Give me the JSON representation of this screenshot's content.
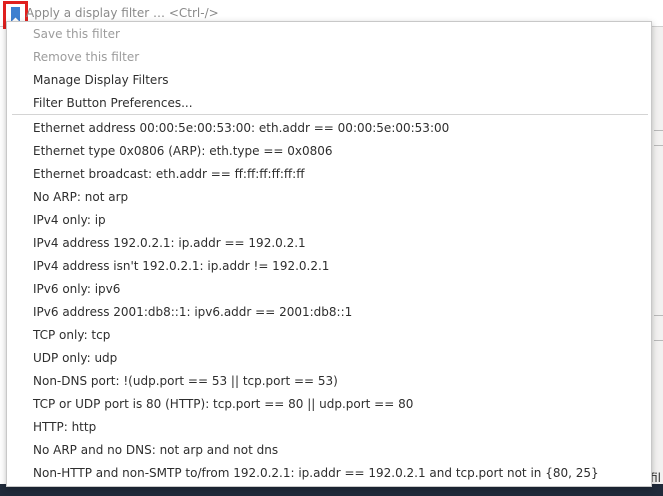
{
  "filter_toolbar": {
    "bookmark_icon": "bookmark-icon",
    "placeholder": "Apply a display filter … <Ctrl-/>"
  },
  "menu": {
    "actions": [
      {
        "label": "Save this filter",
        "enabled": false
      },
      {
        "label": "Remove this filter",
        "enabled": false
      },
      {
        "label": "Manage Display Filters",
        "enabled": true
      },
      {
        "label": "Filter Button Preferences...",
        "enabled": true
      }
    ],
    "saved_filters": [
      "Ethernet address 00:00:5e:00:53:00: eth.addr == 00:00:5e:00:53:00",
      "Ethernet type 0x0806 (ARP): eth.type == 0x0806",
      "Ethernet broadcast: eth.addr == ff:ff:ff:ff:ff:ff",
      "No ARP: not arp",
      "IPv4 only: ip",
      "IPv4 address 192.0.2.1: ip.addr == 192.0.2.1",
      "IPv4 address isn't 192.0.2.1: ip.addr != 192.0.2.1",
      "IPv6 only: ipv6",
      "IPv6 address 2001:db8::1: ipv6.addr == 2001:db8::1",
      "TCP only: tcp",
      "UDP only: udp",
      "Non-DNS port: !(udp.port == 53 || tcp.port == 53)",
      "TCP or UDP port is 80 (HTTP): tcp.port == 80 || udp.port == 80",
      "HTTP: http",
      "No ARP and no DNS: not arp and not dns",
      "Non-HTTP and non-SMTP to/from 192.0.2.1: ip.addr == 192.0.2.1 and tcp.port not in {80, 25}"
    ]
  },
  "background": {
    "partial_text": "fil"
  },
  "colors": {
    "highlight_border": "#e0201e",
    "bookmark_blue": "#3d7fd0",
    "disabled_text": "#9c9c9c"
  }
}
